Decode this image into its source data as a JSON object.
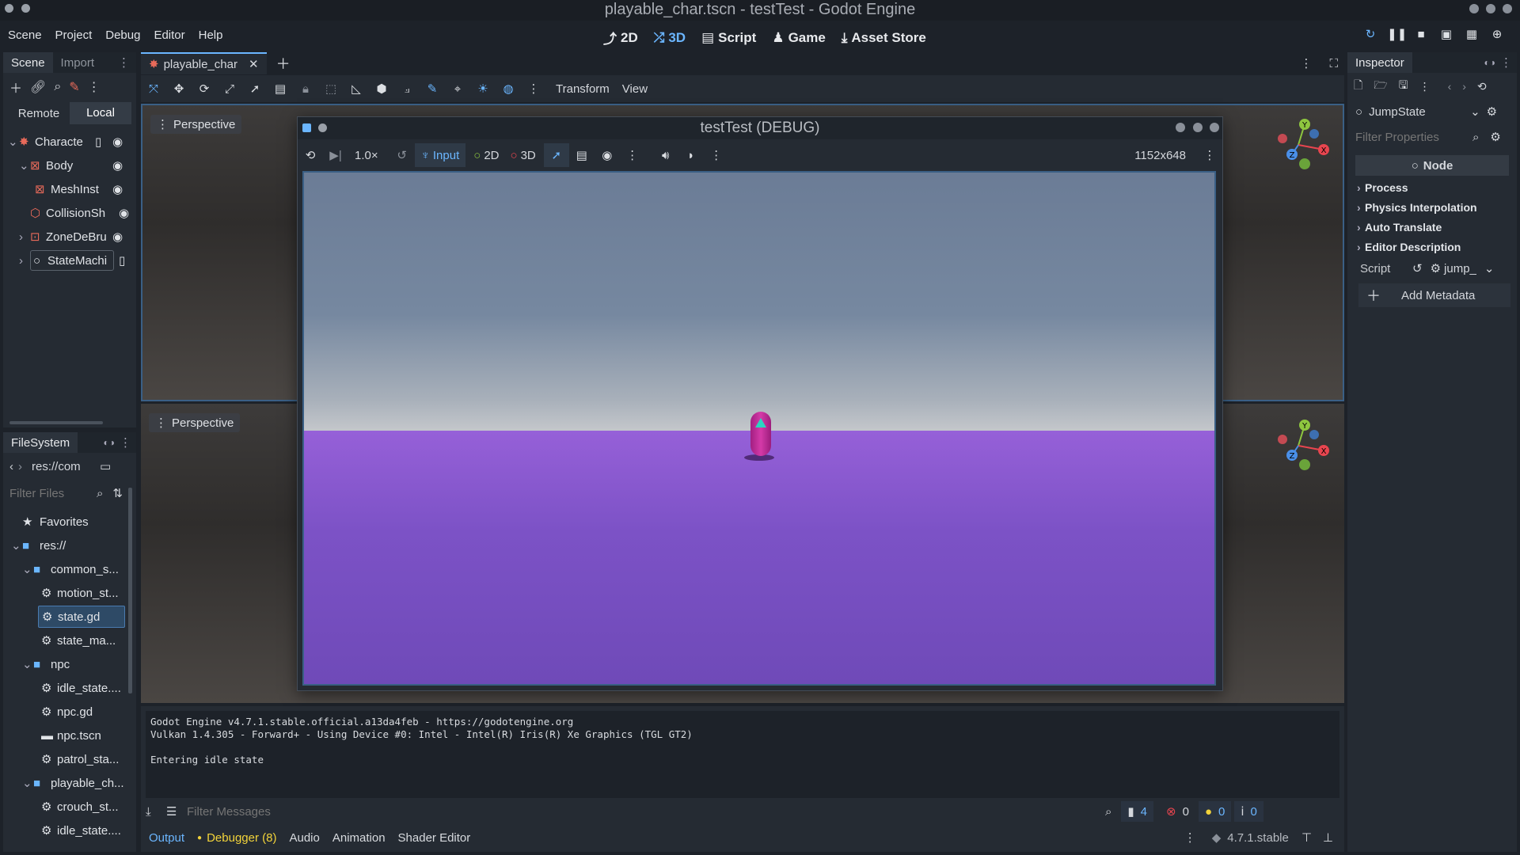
{
  "window": {
    "title": "playable_char.tscn - testTest - Godot Engine"
  },
  "menu": [
    "Scene",
    "Project",
    "Debug",
    "Editor",
    "Help"
  ],
  "modes": [
    {
      "label": "2D"
    },
    {
      "label": "3D"
    },
    {
      "label": "Script"
    },
    {
      "label": "Game"
    },
    {
      "label": "Asset Store"
    }
  ],
  "scene_dock": {
    "tabs": [
      "Scene",
      "Import"
    ],
    "remote": "Remote",
    "local": "Local",
    "tree": [
      "Characte",
      "Body",
      "MeshInst",
      "CollisionSh",
      "ZoneDeBru",
      "StateMachi"
    ]
  },
  "filesystem": {
    "tab": "FileSystem",
    "path": "res://com",
    "filter_placeholder": "Filter Files",
    "items": [
      "Favorites",
      "res://",
      "common_s...",
      "motion_st...",
      "state.gd",
      "state_ma...",
      "npc",
      "idle_state....",
      "npc.gd",
      "npc.tscn",
      "patrol_sta...",
      "playable_ch...",
      "crouch_st...",
      "idle_state...."
    ]
  },
  "editor_tab": {
    "label": "playable_char"
  },
  "toolbar": {
    "transform": "Transform",
    "view": "View"
  },
  "viewports": {
    "top": "Perspective",
    "bottom": "Perspective"
  },
  "game_window": {
    "title": "testTest (DEBUG)",
    "speed": "1.0×",
    "input": "Input",
    "two_d": "2D",
    "three_d": "3D",
    "resolution": "1152x648"
  },
  "gizmo": {
    "y": "Y",
    "x": "X",
    "z": "Z"
  },
  "inspector": {
    "tab": "Inspector",
    "node_name": "JumpState",
    "filter_placeholder": "Filter Properties",
    "section": "Node",
    "groups": [
      "Process",
      "Physics Interpolation",
      "Auto Translate",
      "Editor Description"
    ],
    "script_label": "Script",
    "script_value": "jump_",
    "add_metadata": "Add Metadata"
  },
  "output": {
    "lines": [
      "Godot Engine v4.7.1.stable.official.a13da4feb - https://godotengine.org",
      "Vulkan 1.4.305 - Forward+ - Using Device #0: Intel - Intel(R) Iris(R) Xe Graphics (TGL GT2)",
      "",
      "Entering idle state"
    ],
    "filter_placeholder": "Filter Messages",
    "counts": {
      "messages": "4",
      "errors": "0",
      "warnings": "0",
      "info": "0"
    }
  },
  "bottom_tabs": [
    "Output",
    "Debugger (8)",
    "Audio",
    "Animation",
    "Shader Editor"
  ],
  "version": "4.7.1.stable",
  "colors": {
    "accent": "#6bb6ff",
    "bg": "#1d2229",
    "panel": "#252b33",
    "ground": "#7a4fc6",
    "sky": "#6e7f98",
    "capsule": "#c62a9e"
  }
}
